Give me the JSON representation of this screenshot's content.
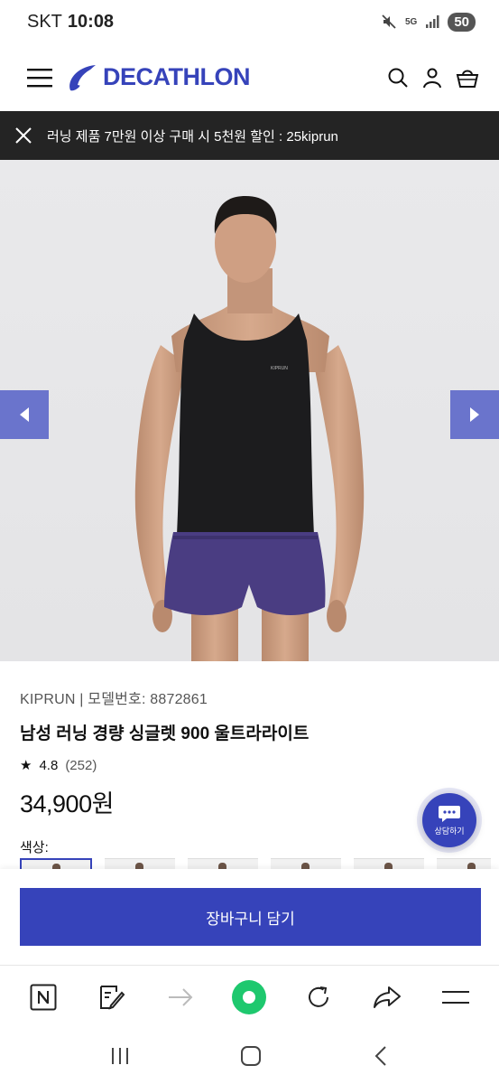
{
  "status_bar": {
    "carrier": "SKT",
    "time": "10:08",
    "network": "5G",
    "battery": "50"
  },
  "header": {
    "brand": "DECATHLON"
  },
  "promo": {
    "text": "러닝 제품 7만원 이상 구매 시 5천원 할인 : 25kiprun"
  },
  "product": {
    "brand_model": "KIPRUN | 모델번호: 8872861",
    "name": "남성 러닝 경량 싱글렛 900 울트라라이트",
    "rating_star": "★",
    "rating": "4.8",
    "review_count": "(252)",
    "price": "34,900원",
    "color_label": "색상:",
    "shirt_logo": "KIPRUN"
  },
  "chat": {
    "label": "상담하기"
  },
  "cart": {
    "button_label": "장바구니 담기"
  },
  "colors": {
    "brand_blue": "#3643ba",
    "arrow_bg": "#6a74cc",
    "promo_bg": "#242424",
    "green": "#1ec86e"
  }
}
